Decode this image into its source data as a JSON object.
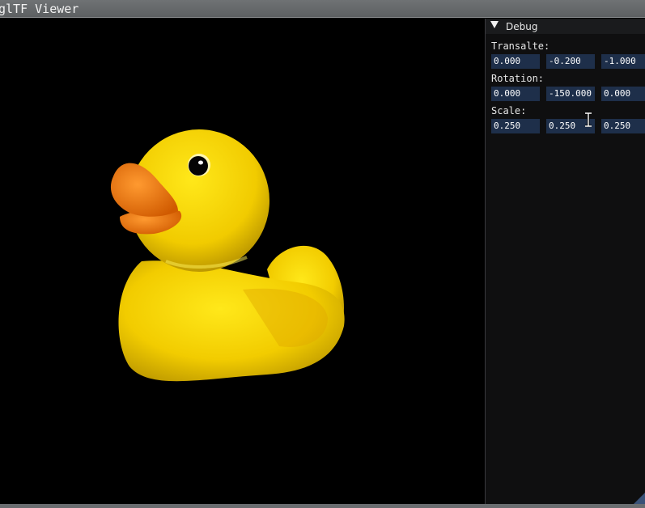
{
  "window": {
    "title": "glTF Viewer"
  },
  "debug": {
    "header": "Debug",
    "translate": {
      "label": "Transalte:",
      "values": [
        "0.000",
        "-0.200",
        "-1.000"
      ]
    },
    "rotation": {
      "label": "Rotation:",
      "values": [
        "0.000",
        "-150.000",
        "0.000"
      ]
    },
    "scale": {
      "label": "Scale:",
      "values": [
        "0.250",
        "0.250",
        "0.250"
      ]
    }
  },
  "colors": {
    "duck_body": "#f5d400",
    "duck_beak": "#f07a10",
    "field_bg": "#1e2f4a",
    "panel_bg": "#0f0f10"
  },
  "icons": [
    "collapse-arrow-icon",
    "ibeam-cursor-icon",
    "resize-grip-icon"
  ]
}
